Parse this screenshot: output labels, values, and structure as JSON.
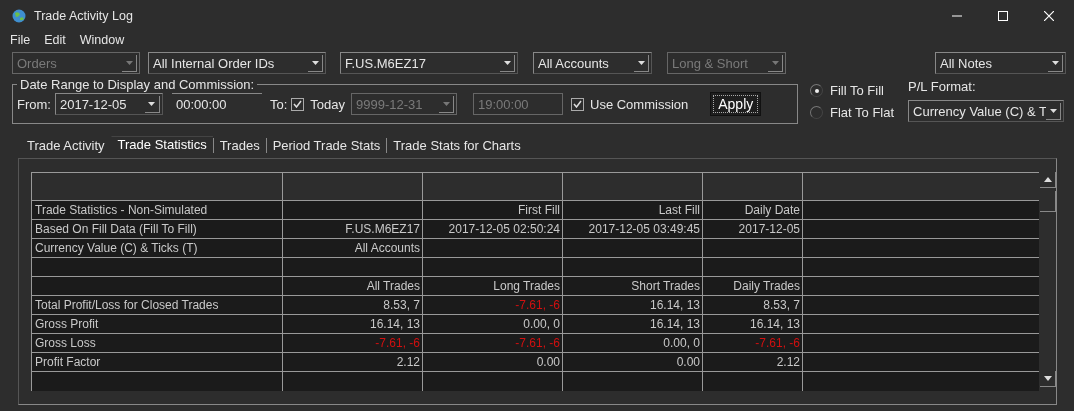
{
  "window": {
    "title": "Trade Activity Log"
  },
  "menu": [
    "File",
    "Edit",
    "Window"
  ],
  "filters": [
    {
      "value": "Orders",
      "disabled": true
    },
    {
      "value": "All Internal Order IDs",
      "disabled": false
    },
    {
      "value": "F.US.M6EZ17",
      "disabled": false
    },
    {
      "value": "All Accounts",
      "disabled": false
    },
    {
      "value": "Long & Short",
      "disabled": true
    }
  ],
  "notes_filter": {
    "value": "All Notes",
    "disabled": false
  },
  "date_range": {
    "legend": "Date Range to Display and Commission:",
    "from_label": "From:",
    "from_date": "2017-12-05",
    "from_time": "00:00:00",
    "to_label": "To:",
    "today": {
      "label": "Today",
      "checked": true
    },
    "to_date": {
      "value": "9999-12-31",
      "disabled": true
    },
    "to_time": {
      "value": "19:00:00",
      "disabled": true
    },
    "use_commission": {
      "label": "Use Commission",
      "checked": true
    },
    "apply": "Apply"
  },
  "fill_mode": [
    {
      "label": "Fill To Fill",
      "selected": true
    },
    {
      "label": "Flat To Flat",
      "selected": false
    }
  ],
  "pl_format": {
    "label": "P/L Format:",
    "value": "Currency Value (C) & T"
  },
  "tabs": [
    {
      "label": "Trade Activity",
      "selected": false
    },
    {
      "label": "Trade Statistics",
      "selected": true
    },
    {
      "label": "Trades",
      "selected": false
    },
    {
      "label": "Period Trade Stats",
      "selected": false
    },
    {
      "label": "Trade Stats for Charts",
      "selected": false
    }
  ],
  "table": {
    "rows": [
      [
        null,
        null,
        null,
        null,
        null
      ],
      [
        {
          "text": "Trade Statistics - Non-Simulated",
          "loss": false
        },
        null,
        {
          "text": "First Fill",
          "loss": false
        },
        {
          "text": "Last Fill",
          "loss": false
        },
        {
          "text": "Daily Date",
          "loss": false
        }
      ],
      [
        {
          "text": "Based On Fill Data (Fill To Fill)",
          "loss": false
        },
        {
          "text": "F.US.M6EZ17",
          "loss": false
        },
        {
          "text": "2017-12-05  02:50:24",
          "loss": false
        },
        {
          "text": "2017-12-05  03:49:45",
          "loss": false
        },
        {
          "text": "2017-12-05",
          "loss": false
        }
      ],
      [
        {
          "text": "Currency Value (C) & Ticks (T)",
          "loss": false
        },
        {
          "text": "All Accounts",
          "loss": false
        },
        null,
        null,
        null
      ],
      [
        null,
        null,
        null,
        null,
        null
      ],
      [
        null,
        {
          "text": "All Trades",
          "loss": false
        },
        {
          "text": "Long Trades",
          "loss": false
        },
        {
          "text": "Short Trades",
          "loss": false
        },
        {
          "text": "Daily Trades",
          "loss": false
        }
      ],
      [
        {
          "text": "Total Profit/Loss for Closed Trades",
          "loss": false
        },
        {
          "text": "8.53, 7",
          "loss": false
        },
        {
          "text": "-7.61, -6",
          "loss": true
        },
        {
          "text": "16.14, 13",
          "loss": false
        },
        {
          "text": "8.53, 7",
          "loss": false
        }
      ],
      [
        {
          "text": "Gross Profit",
          "loss": false
        },
        {
          "text": "16.14, 13",
          "loss": false
        },
        {
          "text": "0.00, 0",
          "loss": false
        },
        {
          "text": "16.14, 13",
          "loss": false
        },
        {
          "text": "16.14, 13",
          "loss": false
        }
      ],
      [
        {
          "text": "Gross Loss",
          "loss": false
        },
        {
          "text": "-7.61, -6",
          "loss": true
        },
        {
          "text": "-7.61, -6",
          "loss": true
        },
        {
          "text": "0.00, 0",
          "loss": false
        },
        {
          "text": "-7.61, -6",
          "loss": true
        }
      ],
      [
        {
          "text": "Profit Factor",
          "loss": false
        },
        {
          "text": "2.12",
          "loss": false
        },
        {
          "text": "0.00",
          "loss": false
        },
        {
          "text": "0.00",
          "loss": false
        },
        {
          "text": "2.12",
          "loss": false
        }
      ],
      [
        null,
        null,
        null,
        null,
        null
      ]
    ]
  }
}
